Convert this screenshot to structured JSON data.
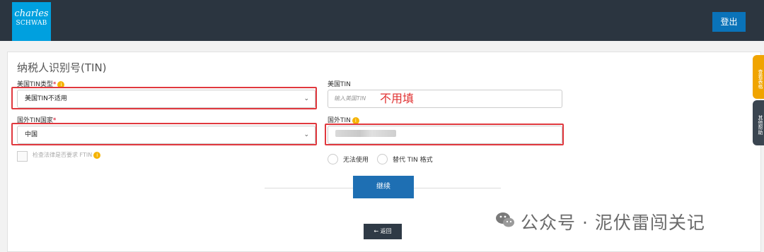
{
  "header": {
    "logo_line1": "charles",
    "logo_line2": "SCHWAB",
    "logout_label": "登出"
  },
  "form": {
    "title": "纳税人识别号(TIN)",
    "us_tin_type": {
      "label": "美国TIN类型",
      "required_mark": "*",
      "value": "美国TIN不适用"
    },
    "us_tin": {
      "label": "美国TIN",
      "placeholder": "输入美国TIN"
    },
    "annotation": "不用填",
    "foreign_tin_country": {
      "label": "国外TIN国家",
      "required_mark": "*",
      "value": "中国"
    },
    "foreign_tin": {
      "label": "国外TIN"
    },
    "check_law_label": "检查法律是否要求 FTIN",
    "radio_unavailable": "无法使用",
    "radio_alt_format": "替代 TIN 格式",
    "continue_label": "继续",
    "back_label": "返回"
  },
  "side_tabs": {
    "tab1": "查看表格",
    "tab2": "其他帮助"
  },
  "watermark": {
    "text": "公众号 · 泥伏雷闯关记"
  },
  "colors": {
    "topbar": "#2b3540",
    "brand": "#00a0df",
    "primary_button": "#1e6fb3",
    "highlight_box": "#e0383e",
    "info": "#f5b301"
  }
}
